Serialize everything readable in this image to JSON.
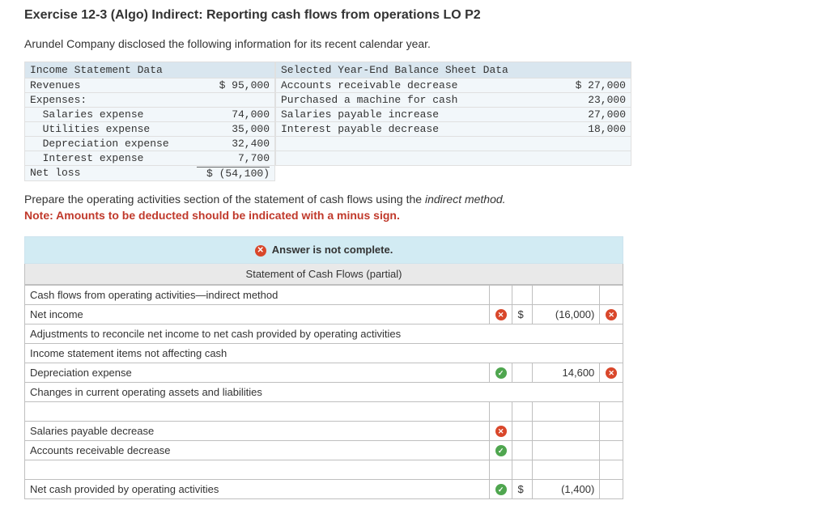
{
  "title": "Exercise 12-3 (Algo) Indirect: Reporting cash flows from operations LO P2",
  "intro": "Arundel Company disclosed the following information for its recent calendar year.",
  "income_statement": {
    "header": "Income Statement Data",
    "rows": [
      {
        "label": "Revenues",
        "amount": "$ 95,000"
      },
      {
        "label": "Expenses:",
        "amount": ""
      },
      {
        "label": "  Salaries expense",
        "amount": "74,000"
      },
      {
        "label": "  Utilities expense",
        "amount": "35,000"
      },
      {
        "label": "  Depreciation expense",
        "amount": "32,400"
      },
      {
        "label": "  Interest expense",
        "amount": "7,700"
      }
    ],
    "total": {
      "label": "Net loss",
      "amount": "$ (54,100)"
    }
  },
  "balance": {
    "header": "Selected Year-End Balance Sheet Data",
    "rows": [
      {
        "label": "Accounts receivable decrease",
        "amount": "$ 27,000"
      },
      {
        "label": "Purchased a machine for cash",
        "amount": "23,000"
      },
      {
        "label": "Salaries payable increase",
        "amount": "27,000"
      },
      {
        "label": "Interest payable decrease",
        "amount": "18,000"
      },
      {
        "label": "",
        "amount": ""
      },
      {
        "label": "",
        "amount": ""
      }
    ]
  },
  "prompt_plain": "Prepare the operating activities section of the statement of cash flows using the ",
  "prompt_italic": "indirect method.",
  "note": "Note: Amounts to be deducted should be indicated with a minus sign.",
  "answer_banner": "Answer is not complete.",
  "stmt_header": "Statement of Cash Flows (partial)",
  "rows": {
    "r1": {
      "desc": "Cash flows from operating activities—indirect method"
    },
    "r2": {
      "desc": "Net income",
      "mark": "x",
      "cur": "$",
      "val": "(16,000)",
      "vmark": "x"
    },
    "r3": {
      "desc": "Adjustments to reconcile net income to net cash provided by operating activities"
    },
    "r4": {
      "desc": "Income statement items not affecting cash"
    },
    "r5": {
      "desc": "Depreciation expense",
      "mark": "check",
      "val": "14,600",
      "vmark": "x"
    },
    "r6": {
      "desc": "Changes in current operating assets and liabilities"
    },
    "r7": {
      "desc": ""
    },
    "r8": {
      "desc": "Salaries payable decrease",
      "mark": "x"
    },
    "r9": {
      "desc": "Accounts receivable decrease",
      "mark": "check"
    },
    "r10": {
      "desc": ""
    },
    "r11": {
      "desc": "Net cash provided by operating activities",
      "mark": "check",
      "cur": "$",
      "val": "(1,400)"
    }
  }
}
